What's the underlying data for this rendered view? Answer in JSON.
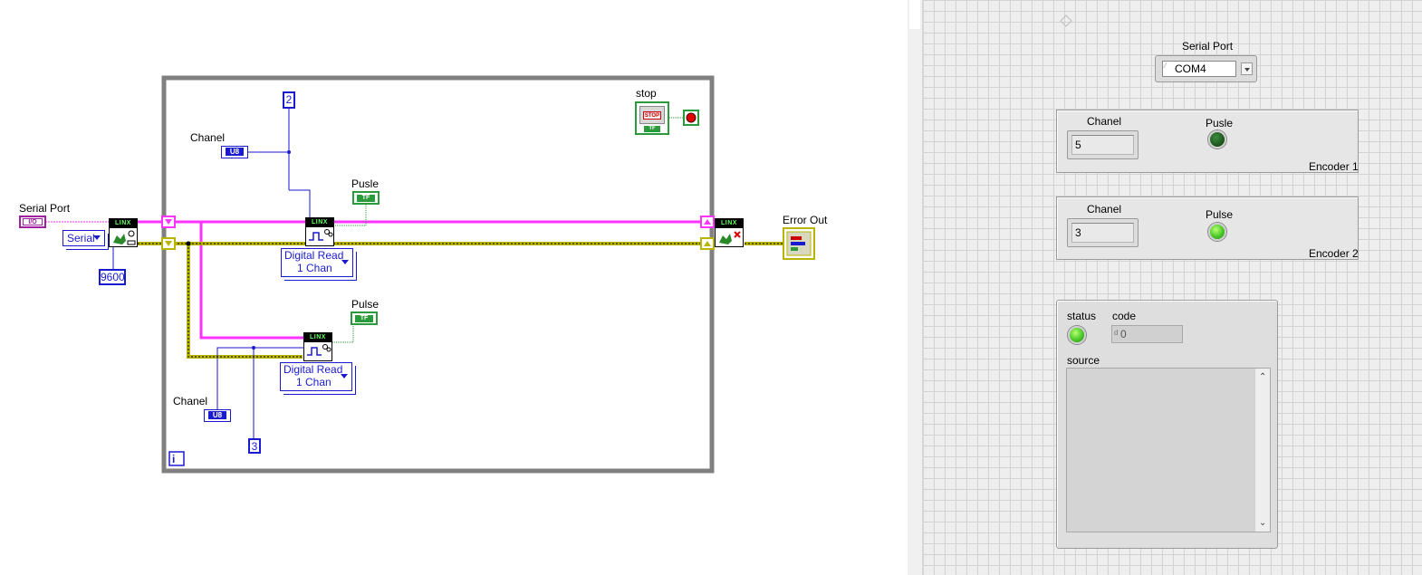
{
  "block_diagram": {
    "labels": {
      "serial_port": "Serial Port",
      "serial_mode": "Serial",
      "baud": "9600",
      "chanel_top": "Chanel",
      "const_top": "2",
      "pusle": "Pusle",
      "read_mode_1_line1": "Digital Read",
      "read_mode_1_line2": "1 Chan",
      "pulse": "Pulse",
      "read_mode_2_line1": "Digital Read",
      "read_mode_2_line2": "1 Chan",
      "chanel_bottom": "Chanel",
      "const_bottom": "3",
      "stop": "stop",
      "error_out": "Error Out",
      "u8_tag": "U8",
      "tf_tag": "TF",
      "io_tag": "I/O",
      "linx_tag": "LINX",
      "stop_tag": "STOP",
      "iteration": "i"
    },
    "colors": {
      "refnum_wire": "#ff33ff",
      "error_wire": "#b8b400",
      "u8_wire": "#1a1ad0",
      "bool_wire": "#2a9a3a",
      "loop_frame": "#808080"
    }
  },
  "front_panel": {
    "serial_port": {
      "label": "Serial Port",
      "value": "COM4"
    },
    "encoder1": {
      "caption": "Encoder 1",
      "chanel_label": "Chanel",
      "chanel_value": "5",
      "pulse_label": "Pusle",
      "pulse_state": "off"
    },
    "encoder2": {
      "caption": "Encoder 2",
      "chanel_label": "Chanel",
      "chanel_value": "3",
      "pulse_label": "Pulse",
      "pulse_state": "on"
    },
    "error_cluster": {
      "status_label": "status",
      "code_label": "code",
      "code_value": "0",
      "source_label": "source",
      "source_value": "",
      "status_state": "on"
    }
  }
}
